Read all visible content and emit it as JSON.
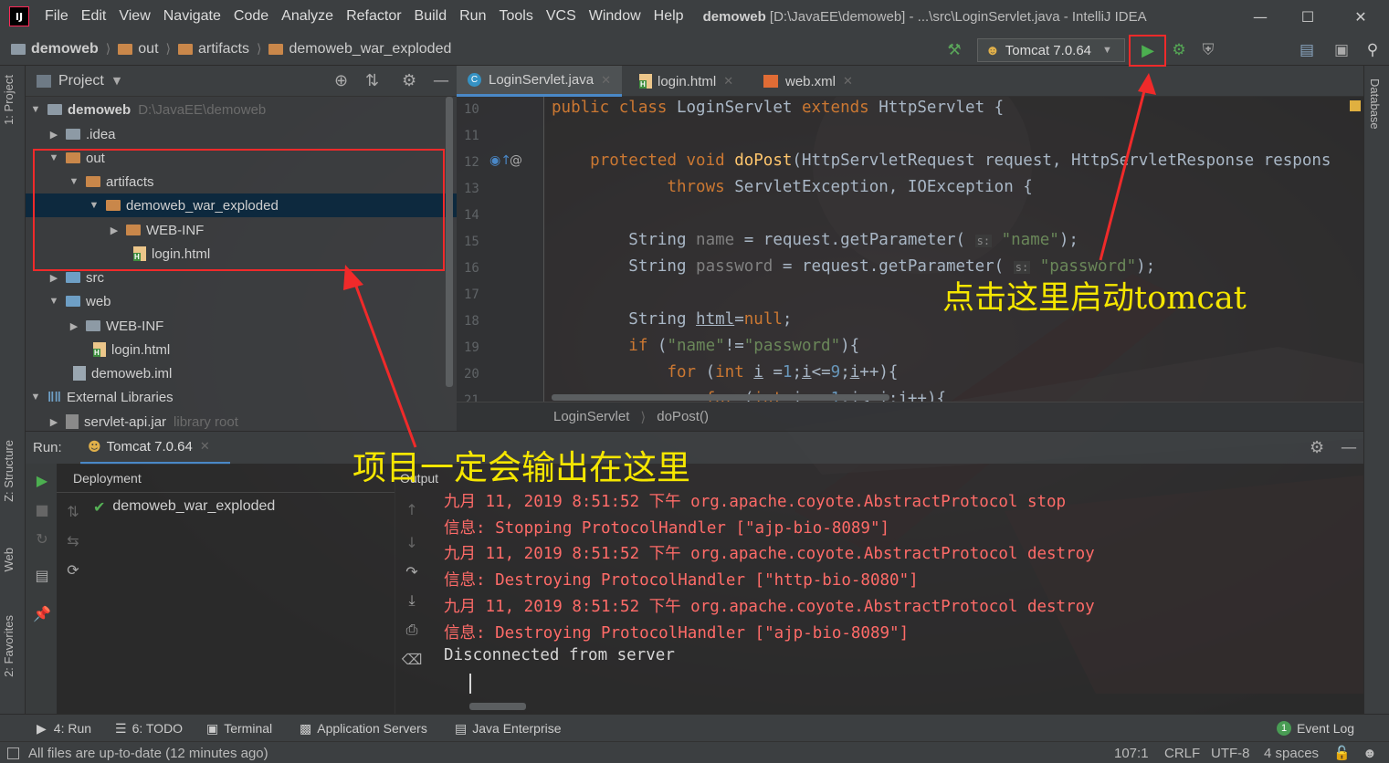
{
  "window": {
    "menu": [
      "File",
      "Edit",
      "View",
      "Navigate",
      "Code",
      "Analyze",
      "Refactor",
      "Build",
      "Run",
      "Tools",
      "VCS",
      "Window",
      "Help"
    ],
    "title_project": "demoweb",
    "title_rest": "[D:\\JavaEE\\demoweb] - ...\\src\\LoginServlet.java - IntelliJ IDEA"
  },
  "navbar": {
    "breadcrumbs": [
      "demoweb",
      "out",
      "artifacts",
      "demoweb_war_exploded"
    ],
    "run_config": "Tomcat 7.0.64"
  },
  "left_strip": {
    "project": "1: Project",
    "structure": "Z: Structure",
    "web": "Web",
    "favorites": "2: Favorites"
  },
  "right_strip": {
    "database": "Database"
  },
  "project_panel": {
    "title": "Project",
    "tree": [
      {
        "label": "demoweb",
        "path": "D:\\JavaEE\\demoweb"
      },
      {
        "label": ".idea"
      },
      {
        "label": "out"
      },
      {
        "label": "artifacts"
      },
      {
        "label": "demoweb_war_exploded"
      },
      {
        "label": "WEB-INF"
      },
      {
        "label": "login.html"
      },
      {
        "label": "src"
      },
      {
        "label": "web"
      },
      {
        "label": "WEB-INF"
      },
      {
        "label": "login.html"
      },
      {
        "label": "demoweb.iml"
      },
      {
        "label": "External Libraries"
      },
      {
        "label": "servlet-api.jar",
        "path": "library root"
      }
    ]
  },
  "editor": {
    "tabs": [
      "LoginServlet.java",
      "login.html",
      "web.xml"
    ],
    "line_numbers": [
      "10",
      "11",
      "12",
      "13",
      "14",
      "15",
      "16",
      "17",
      "18",
      "19",
      "20",
      "21"
    ],
    "breadcrumb": [
      "LoginServlet",
      "doPost()"
    ],
    "param_hint": "s:"
  },
  "run_panel": {
    "label": "Run:",
    "tab": "Tomcat 7.0.64",
    "deployment_header": "Deployment",
    "output_header": "Output",
    "deployment_item": "demoweb_war_exploded",
    "output_lines": [
      {
        "text": "九月 11, 2019 8:51:52 下午 org.apache.coyote.AbstractProtocol stop",
        "color": "#ff6b68"
      },
      {
        "text": "信息: Stopping ProtocolHandler [\"ajp-bio-8089\"]",
        "color": "#ff6b68"
      },
      {
        "text": "九月 11, 2019 8:51:52 下午 org.apache.coyote.AbstractProtocol destroy",
        "color": "#ff6b68"
      },
      {
        "text": "信息: Destroying ProtocolHandler [\"http-bio-8080\"]",
        "color": "#ff6b68"
      },
      {
        "text": "九月 11, 2019 8:51:52 下午 org.apache.coyote.AbstractProtocol destroy",
        "color": "#ff6b68"
      },
      {
        "text": "信息: Destroying ProtocolHandler [\"ajp-bio-8089\"]",
        "color": "#ff6b68"
      },
      {
        "text": "Disconnected from server",
        "color": "#d6d6d6"
      }
    ]
  },
  "bottom_tools": {
    "run": "4: Run",
    "todo": "6: TODO",
    "terminal": "Terminal",
    "app_servers": "Application Servers",
    "java_ee": "Java Enterprise",
    "event_log": "Event Log",
    "event_count": "1"
  },
  "status_bar": {
    "message": "All files are up-to-date (12 minutes ago)",
    "position": "107:1",
    "line_sep": "CRLF",
    "encoding": "UTF-8",
    "indent": "4 spaces"
  },
  "annotations": {
    "start_tomcat": "点击这里启动tomcat",
    "output_here": "项目一定会输出在这里"
  },
  "colors": {
    "annotation_red": "#f02a2a",
    "annotation_yellow": "#f5e600",
    "run_green": "#4caf50"
  }
}
